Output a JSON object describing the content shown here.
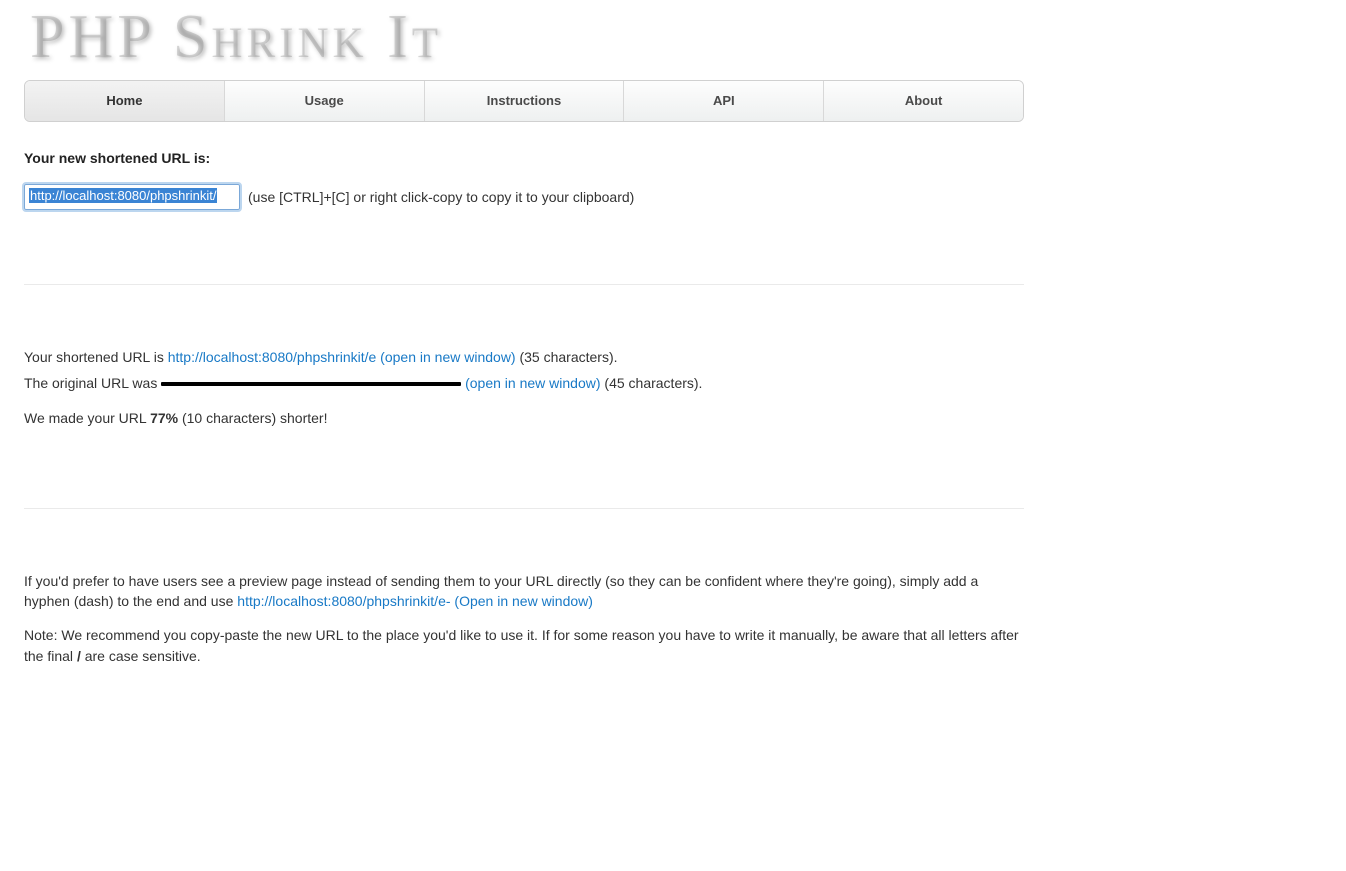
{
  "logo": "PHP Shrink It",
  "nav": {
    "items": [
      {
        "label": "Home",
        "active": true
      },
      {
        "label": "Usage",
        "active": false
      },
      {
        "label": "Instructions",
        "active": false
      },
      {
        "label": "API",
        "active": false
      },
      {
        "label": "About",
        "active": false
      }
    ]
  },
  "result": {
    "heading": "Your new shortened URL is:",
    "boxed_url": "http://localhost:8080/phpshrinkit/",
    "copy_hint": "(use [CTRL]+[C] or right click-copy to copy it to your clipboard)"
  },
  "stats": {
    "shortened_intro": "Your shortened URL is ",
    "shortened_link": "http://localhost:8080/phpshrinkit/e (open in new window)",
    "shortened_chars": " (35 characters).",
    "original_intro": "The original URL was ",
    "original_open": " (open in new window)",
    "original_chars": " (45 characters).",
    "made_intro": "We made your URL ",
    "made_bold": "77%",
    "made_rest": " (10 characters) shorter!"
  },
  "preview": {
    "intro": "If you'd prefer to have users see a preview page instead of sending them to your URL directly (so they can be confident where they're going), simply add a hyphen (dash) to the end and use ",
    "link": "http://localhost:8080/phpshrinkit/e- (Open in new window)"
  },
  "note": {
    "part1": "Note: We recommend you copy-paste the new URL to the place you'd like to use it. If for some reason you have to write it manually, be aware that all letters after the final ",
    "slash": "/",
    "part2": " are case sensitive."
  }
}
